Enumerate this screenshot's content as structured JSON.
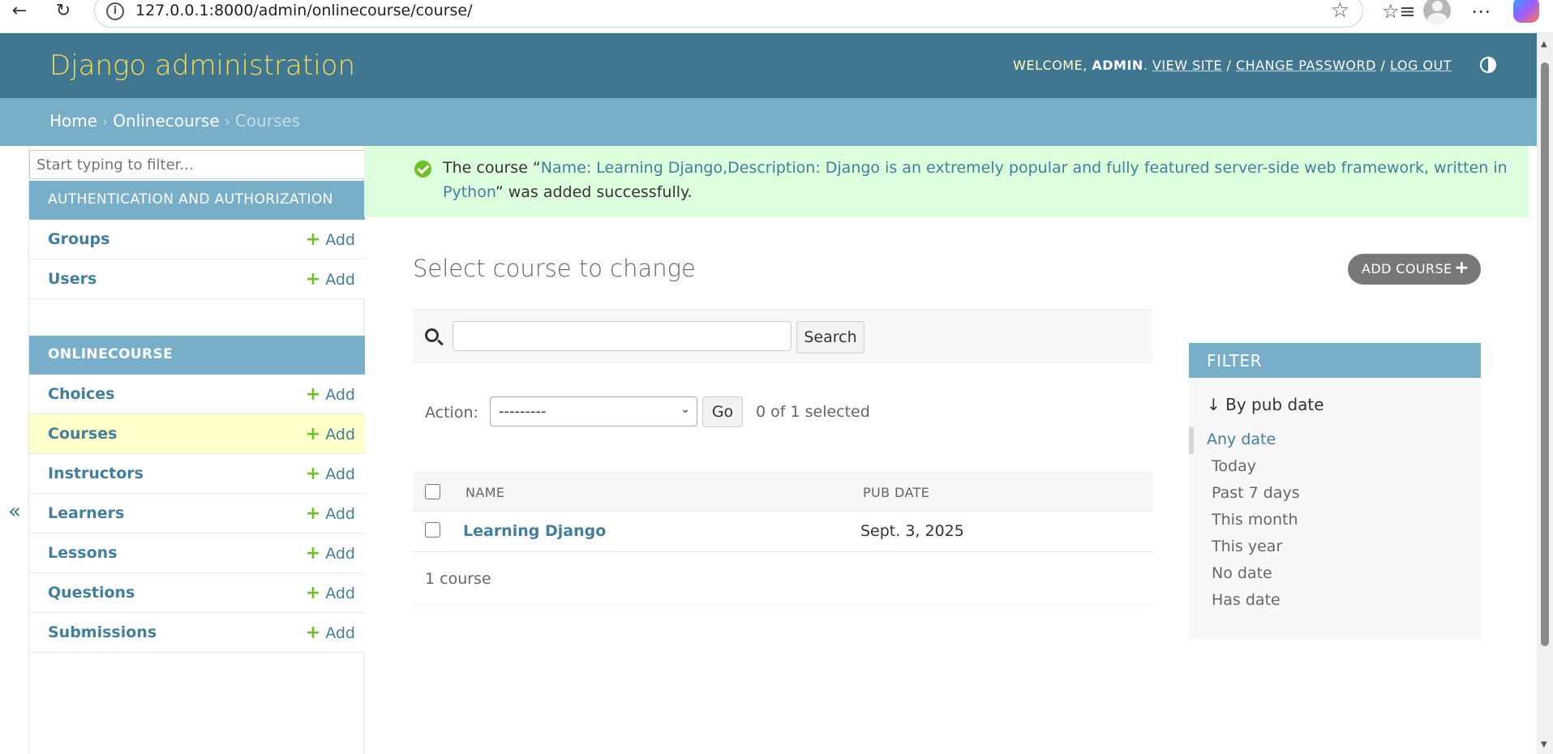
{
  "browser": {
    "url": "127.0.0.1:8000/admin/onlinecourse/course/"
  },
  "header": {
    "branding": "Django administration",
    "welcome": "Welcome,",
    "user": "admin",
    "view_site": "View site",
    "change_password": "Change password",
    "log_out": "Log out"
  },
  "breadcrumbs": {
    "home": "Home",
    "app": "Onlinecourse",
    "current": "Courses"
  },
  "sidebar": {
    "filter_placeholder": "Start typing to filter...",
    "collapse": "«",
    "add_label": "Add",
    "modules": [
      {
        "caption": "Authentication and Authorization",
        "models": [
          "Groups",
          "Users"
        ]
      },
      {
        "caption": "Onlinecourse",
        "models": [
          "Choices",
          "Courses",
          "Instructors",
          "Learners",
          "Lessons",
          "Questions",
          "Submissions"
        ]
      }
    ]
  },
  "message": {
    "prefix": "The course “",
    "link": "Name: Learning Django,Description: Django is an extremely popular and fully featured server-side web framework, written in Python",
    "suffix": "” was added successfully."
  },
  "main": {
    "title": "Select course to change",
    "add_button": "Add course",
    "search_button": "Search",
    "search_value": "",
    "action_label": "Action:",
    "action_value": "---------",
    "go_button": "Go",
    "selected_count": "0 of 1 selected",
    "columns": [
      "Name",
      "Pub date"
    ],
    "rows": [
      {
        "name": "Learning Django",
        "pub_date": "Sept. 3, 2025"
      }
    ],
    "paginator": "1 course"
  },
  "filter": {
    "caption": "Filter",
    "title": "↓ By pub date",
    "options": [
      "Any date",
      "Today",
      "Past 7 days",
      "This month",
      "This year",
      "No date",
      "Has date"
    ],
    "selected": "Any date"
  },
  "colors": {
    "header": "#417690",
    "breadcrumbs": "#79aec8",
    "success": "#dfd",
    "link": "#447e9b",
    "add_plus": "#70bf2b"
  }
}
